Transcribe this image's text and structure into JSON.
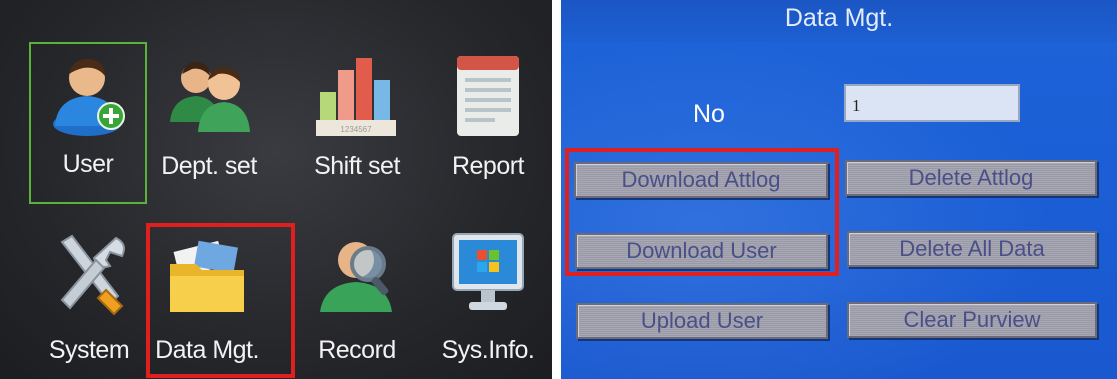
{
  "main_menu": {
    "items": [
      {
        "label": "User",
        "icon": "user-add-icon"
      },
      {
        "label": "Dept. set",
        "icon": "users-group-icon"
      },
      {
        "label": "Shift set",
        "icon": "bar-chart-icon"
      },
      {
        "label": "Report",
        "icon": "report-icon"
      },
      {
        "label": "System",
        "icon": "tools-icon"
      },
      {
        "label": "Data Mgt.",
        "icon": "folder-icon"
      },
      {
        "label": "Record",
        "icon": "user-search-icon"
      },
      {
        "label": "Sys.Info.",
        "icon": "monitor-icon"
      }
    ],
    "selected": "User",
    "highlighted": "Data Mgt."
  },
  "data_mgt": {
    "title": "Data Mgt.",
    "no_label": "No",
    "no_value": "1",
    "buttons": {
      "download_attlog": "Download Attlog",
      "delete_attlog": "Delete Attlog",
      "download_user": "Download User",
      "delete_all_data": "Delete All Data",
      "upload_user": "Upload User",
      "clear_purview": "Clear Purview"
    }
  },
  "colors": {
    "highlight": "#e0201f",
    "selection_border": "#59b33a",
    "screen_blue": "#1d5fd6",
    "button_gray": "#a4a4b0"
  }
}
